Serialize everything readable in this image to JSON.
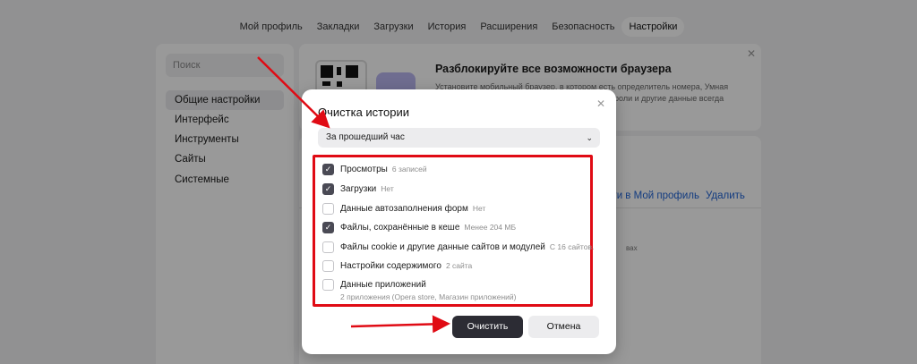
{
  "topnav": {
    "tabs": [
      {
        "label": "Мой профиль"
      },
      {
        "label": "Закладки"
      },
      {
        "label": "Загрузки"
      },
      {
        "label": "История"
      },
      {
        "label": "Расширения"
      },
      {
        "label": "Безопасность"
      },
      {
        "label": "Настройки",
        "active": true
      }
    ]
  },
  "sidebar": {
    "search_placeholder": "Поиск",
    "items": [
      {
        "label": "Общие настройки",
        "active": true
      },
      {
        "label": "Интерфейс"
      },
      {
        "label": "Инструменты"
      },
      {
        "label": "Сайты"
      },
      {
        "label": "Системные"
      }
    ]
  },
  "promo": {
    "title": "Разблокируйте все возможности браузера",
    "text_line1": "Установите мобильный браузер, в котором есть определитель номера, Умная",
    "text_line2": "роли и другие данные всегда"
  },
  "background_fragments": {
    "profile_link": "йти в Мой профиль",
    "delete_link": "Удалить",
    "small_text": "вах"
  },
  "dialog": {
    "title": "Очистка истории",
    "period": {
      "selected": "За прошедший час"
    },
    "options": [
      {
        "label": "Просмотры",
        "note": "6 записей",
        "checked": true
      },
      {
        "label": "Загрузки",
        "note": "Нет",
        "checked": true
      },
      {
        "label": "Данные автозаполнения форм",
        "note": "Нет",
        "checked": false
      },
      {
        "label": "Файлы, сохранённые в кеше",
        "note": "Менее 204 МБ",
        "checked": true
      },
      {
        "label": "Файлы cookie и другие данные сайтов и модулей",
        "note": "С 16 сайтов.",
        "checked": false
      },
      {
        "label": "Настройки содержимого",
        "note": "2 сайта",
        "checked": false
      },
      {
        "label": "Данные приложений",
        "note": "",
        "checked": false,
        "sub": "2 приложения (Opera store, Магазин приложений)"
      }
    ],
    "clear_label": "Очистить",
    "cancel_label": "Отмена"
  },
  "icons": {
    "close": "close-icon",
    "chevron": "chevron-down-icon",
    "check": "check-icon"
  },
  "colors": {
    "highlight_red": "#e00b14",
    "primary_button": "#2c2c34",
    "link_blue": "#1f63d6"
  }
}
